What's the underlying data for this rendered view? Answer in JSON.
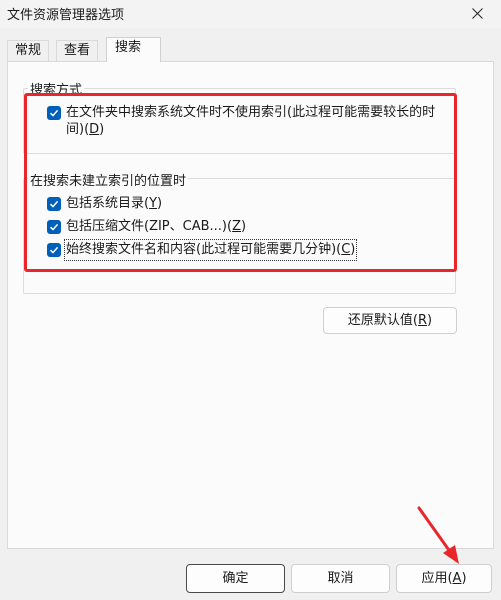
{
  "window": {
    "title": "文件资源管理器选项"
  },
  "tabs": [
    {
      "label": "常规",
      "active": false
    },
    {
      "label": "查看",
      "active": false
    },
    {
      "label": "搜索",
      "active": true
    }
  ],
  "search_method": {
    "title": "搜索方式",
    "option": {
      "line1": "在文件夹中搜索系统文件时不使用索引(此过程可能需要较长的时",
      "line2_pre": "间)(",
      "line2_key": "D",
      "line2_post": ")",
      "checked": true
    }
  },
  "unindexed": {
    "title": "在搜索未建立索引的位置时",
    "items": [
      {
        "pre": "包括系统目录(",
        "key": "Y",
        "post": ")",
        "checked": true
      },
      {
        "pre": "包括压缩文件(ZIP、CAB...)(",
        "key": "Z",
        "post": ")",
        "checked": true
      },
      {
        "pre": "始终搜索文件名和内容(此过程可能需要几分钟)(",
        "key": "C",
        "post": ")",
        "checked": true
      }
    ]
  },
  "restore_defaults": {
    "pre": "还原默认值(",
    "key": "R",
    "post": ")"
  },
  "footer": {
    "ok": "确定",
    "cancel": "取消",
    "apply_pre": "应用(",
    "apply_key": "A",
    "apply_post": ")"
  },
  "colors": {
    "accent": "#005fb8",
    "highlight": "#e8262b"
  }
}
